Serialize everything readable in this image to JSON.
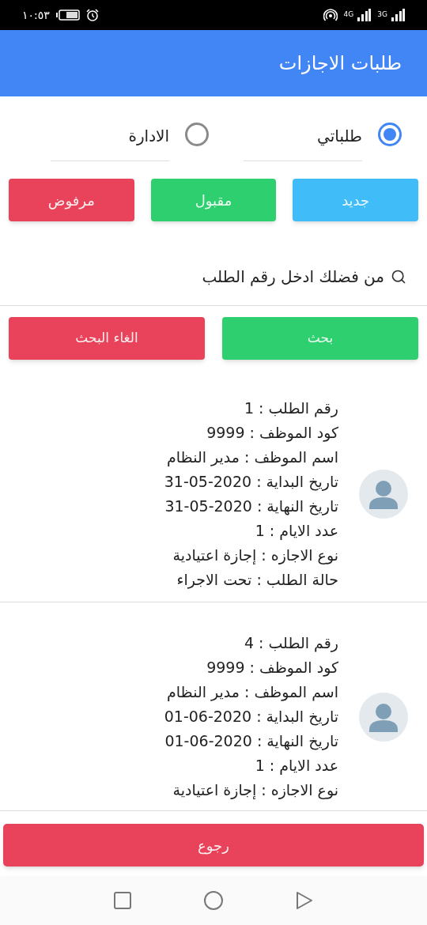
{
  "status_bar": {
    "time": "١٠:٥٣",
    "network_1": "4G",
    "network_2": "3G"
  },
  "app_bar": {
    "title": "طلبات الاجازات"
  },
  "scope_options": [
    {
      "label": "طلباتي",
      "selected": true
    },
    {
      "label": "الادارة",
      "selected": false
    }
  ],
  "status_filters": [
    {
      "label": "جديد",
      "color": "#40bcf9"
    },
    {
      "label": "مقبول",
      "color": "#2ecf6f"
    },
    {
      "label": "مرفوض",
      "color": "#e8435a"
    }
  ],
  "search": {
    "placeholder": "من فضلك ادخل رقم الطلب"
  },
  "search_actions": [
    {
      "label": "بحث",
      "color": "#2ecf6f"
    },
    {
      "label": "الغاء البحث",
      "color": "#e8435a"
    }
  ],
  "requests": [
    {
      "lines": [
        "رقم الطلب : 1",
        "كود الموظف : 9999",
        "اسم الموظف : مدير النظام",
        "تاريخ البداية : 2020-05-31",
        "تاريخ النهاية : 2020-05-31",
        "عدد الايام : 1",
        "نوع الاجازه : إجازة اعتيادية",
        "حالة الطلب : تحت الاجراء"
      ]
    },
    {
      "lines": [
        "رقم الطلب : 4",
        "كود الموظف : 9999",
        "اسم الموظف : مدير النظام",
        "تاريخ البداية : 2020-06-01",
        "تاريخ النهاية : 2020-06-01",
        "عدد الايام : 1",
        "نوع الاجازه : إجازة اعتيادية"
      ]
    }
  ],
  "back_button": {
    "label": "رجوع",
    "color": "#e8435a"
  }
}
